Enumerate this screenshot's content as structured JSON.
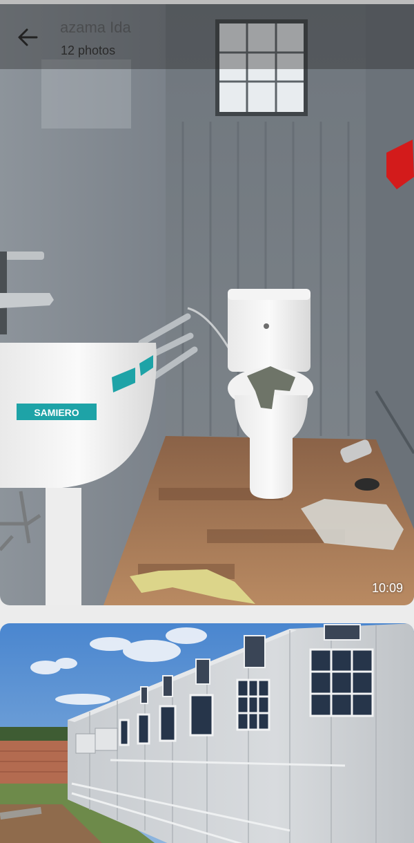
{
  "header": {
    "title": "azama Ida",
    "subtitle": "12 photos"
  },
  "photos": [
    {
      "timestamp": "10:09",
      "sink_brand": "SAMIERO"
    }
  ],
  "icons": {
    "back": "arrow-left-icon"
  }
}
